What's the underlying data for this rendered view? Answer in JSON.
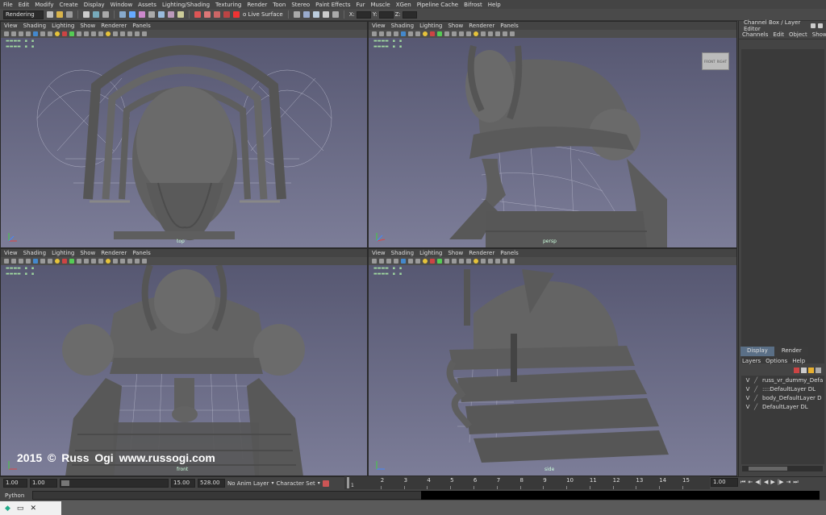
{
  "menubar": {
    "items": [
      "File",
      "Edit",
      "Modify",
      "Create",
      "Display",
      "Window",
      "Assets",
      "Lighting/Shading",
      "Texturing",
      "Render",
      "Toon",
      "Stereo",
      "Paint Effects",
      "Fur",
      "Muscle",
      "XGen",
      "Pipeline Cache",
      "Bifrost",
      "Help"
    ]
  },
  "shelf": {
    "mode": "Rendering",
    "live_surface": "o Live Surface",
    "coord_x": "X:",
    "coord_y": "Y:",
    "coord_z": "Z:"
  },
  "viewport_menu": [
    "View",
    "Shading",
    "Lighting",
    "Show",
    "Renderer",
    "Panels"
  ],
  "viewports": [
    {
      "label": "top"
    },
    {
      "label": "persp"
    },
    {
      "label": "front"
    },
    {
      "label": "side"
    }
  ],
  "viewcube": {
    "left": "FRONT",
    "right": "RIGHT"
  },
  "right_panel": {
    "title": "Channel Box / Layer Editor",
    "menu": [
      "Channels",
      "Edit",
      "Object",
      "Show"
    ],
    "tabs": [
      "Display",
      "Render"
    ],
    "layer_menu": [
      "Layers",
      "Options",
      "Help"
    ],
    "layers": [
      {
        "v": "V",
        "name": "russ_vr_dummy_Defa"
      },
      {
        "v": "V",
        "name": "::::DefaultLayer DL"
      },
      {
        "v": "V",
        "name": "body_DefaultLayer D"
      },
      {
        "v": "V",
        "name": "DefaultLayer DL"
      }
    ]
  },
  "timebar": {
    "start": "1.00",
    "current": "1.00",
    "range_end": "15.00",
    "end": "528.00",
    "anim_layer": "No Anim Layer",
    "char_set": "Character Set",
    "frame": "1.00",
    "ticks": [
      "1",
      "2",
      "3",
      "4",
      "5",
      "6",
      "7",
      "8",
      "9",
      "10",
      "11",
      "12",
      "13",
      "14",
      "15"
    ],
    "current_marker": "1"
  },
  "cmdline": {
    "label": "Python"
  },
  "watermark": "2015 © Russ Ogi   www.russogi.com",
  "colors": {
    "bg": "#444444",
    "viewport_top": "#54556f",
    "viewport_bottom": "#7c7d98",
    "model": "#656565",
    "tab_active": "#5a6f86"
  }
}
